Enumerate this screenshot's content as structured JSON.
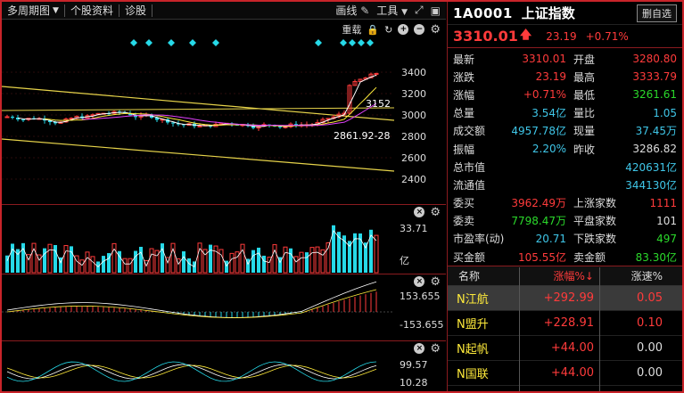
{
  "toolbar": {
    "period": "多周期图",
    "stock_info": "个股资料",
    "diagnose": "诊股",
    "draw": "画线",
    "tools": "工具"
  },
  "kline": {
    "header_label": "重载",
    "y_ticks": [
      "3400",
      "3200",
      "3000",
      "2800",
      "2600",
      "2400"
    ],
    "annot_high": "3152",
    "annot_low": "2861.92-28",
    "colors": {
      "up": "#ff3b3b",
      "down": "#26d9e8",
      "ma1": "#ffffff",
      "ma2": "#ffeb3b",
      "ma3": "#e040fb"
    }
  },
  "volume": {
    "top_value": "33.71",
    "unit": "亿"
  },
  "macd": {
    "top": "153.655",
    "bottom": "-153.655"
  },
  "kdj": {
    "top": "99.57",
    "bottom": "10.28"
  },
  "quote": {
    "code": "1A0001",
    "name": "上证指数",
    "delete_btn": "删自选",
    "price": "3310.01",
    "change": "23.19",
    "percent": "+0.71%"
  },
  "stats": [
    {
      "l1": "最新",
      "v1": "3310.01",
      "c1": "red",
      "l2": "开盘",
      "v2": "3280.80",
      "c2": "red"
    },
    {
      "l1": "涨跌",
      "v1": "23.19",
      "c1": "red",
      "l2": "最高",
      "v2": "3333.79",
      "c2": "red"
    },
    {
      "l1": "涨幅",
      "v1": "+0.71%",
      "c1": "red",
      "l2": "最低",
      "v2": "3261.61",
      "c2": "green"
    },
    {
      "l1": "总量",
      "v1": "3.54亿",
      "c1": "cyan",
      "l2": "量比",
      "v2": "1.05",
      "c2": "cyan"
    },
    {
      "l1": "成交额",
      "v1": "4957.78亿",
      "c1": "cyan",
      "l2": "现量",
      "v2": "37.45万",
      "c2": "cyan"
    },
    {
      "l1": "振幅",
      "v1": "2.20%",
      "c1": "cyan",
      "l2": "昨收",
      "v2": "3286.82",
      "c2": "white"
    },
    {
      "l1": "总市值",
      "v1": "",
      "c1": "cyan",
      "l2": "",
      "v2": "420631亿",
      "c2": "cyan"
    },
    {
      "l1": "流通值",
      "v1": "",
      "c1": "cyan",
      "l2": "",
      "v2": "344130亿",
      "c2": "cyan"
    },
    {
      "l1": "委买",
      "v1": "3962.49万",
      "c1": "red",
      "l2": "上涨家数",
      "v2": "1111",
      "c2": "red"
    },
    {
      "l1": "委卖",
      "v1": "7798.47万",
      "c1": "green",
      "l2": "平盘家数",
      "v2": "101",
      "c2": "white"
    },
    {
      "l1": "市盈率(动)",
      "v1": "20.71",
      "c1": "cyan",
      "l2": "下跌家数",
      "v2": "497",
      "c2": "green"
    },
    {
      "l1": "买金额",
      "v1": "105.55亿",
      "c1": "red",
      "l2": "卖金额",
      "v2": "83.30亿",
      "c2": "green"
    }
  ],
  "list": {
    "headers": [
      "名称",
      "涨幅%↓",
      "涨速%"
    ],
    "rows": [
      {
        "name": "N江航",
        "pct": "+292.99",
        "speed": "0.05",
        "speed_color": "red"
      },
      {
        "name": "N盟升",
        "pct": "+228.91",
        "speed": "0.10",
        "speed_color": "red"
      },
      {
        "name": "N起帆",
        "pct": "+44.00",
        "speed": "0.00",
        "speed_color": "white"
      },
      {
        "name": "N国联",
        "pct": "+44.00",
        "speed": "0.00",
        "speed_color": "white"
      }
    ]
  }
}
